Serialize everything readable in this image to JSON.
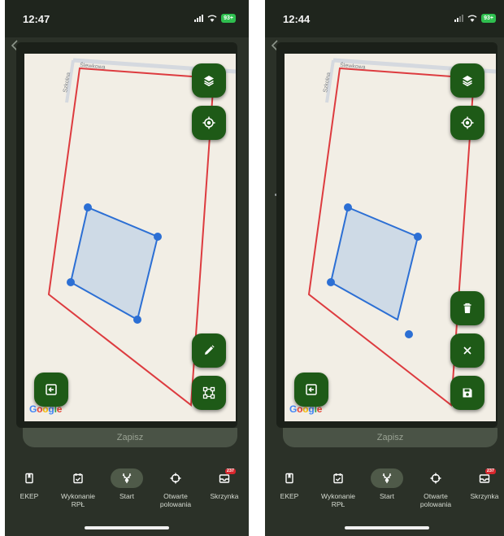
{
  "colors": {
    "fab_green": "#1e5a17",
    "boundary_red": "#dd3b3f",
    "polygon_blue": "#2c6fd4",
    "polygon_fill": "#c8d6e6",
    "map_bg": "#f2eee5",
    "app_bg": "#2b3128",
    "badge_red": "#d7262d",
    "battery_green": "#2fbf4f"
  },
  "map": {
    "street_labels": [
      "Ślewkowa",
      "Szkolna"
    ],
    "attribution": [
      "G",
      "o",
      "o",
      "g",
      "l",
      "e"
    ]
  },
  "save_bar": {
    "label": "Zapisz"
  },
  "tabs": [
    {
      "label": "EKEP",
      "icon": "book-icon"
    },
    {
      "label": "Wykonanie RPŁ",
      "icon": "calendar-check-icon"
    },
    {
      "label": "Start",
      "icon": "antlers-icon",
      "active": true
    },
    {
      "label": "Otwarte polowania",
      "icon": "crosshair-icon"
    },
    {
      "label": "Skrzynka",
      "icon": "inbox-icon",
      "badge": "237"
    }
  ],
  "screens": [
    {
      "status": {
        "time": "12:47",
        "battery": "93+"
      },
      "fabs": [
        "layers-icon",
        "my-location-icon",
        "edit-pencil-icon",
        "polygon-edit-icon",
        "exit-icon"
      ]
    },
    {
      "status": {
        "time": "12:44",
        "battery": "93+"
      },
      "fabs": [
        "layers-icon",
        "my-location-icon",
        "delete-icon",
        "close-icon",
        "save-icon",
        "exit-icon"
      ]
    }
  ]
}
